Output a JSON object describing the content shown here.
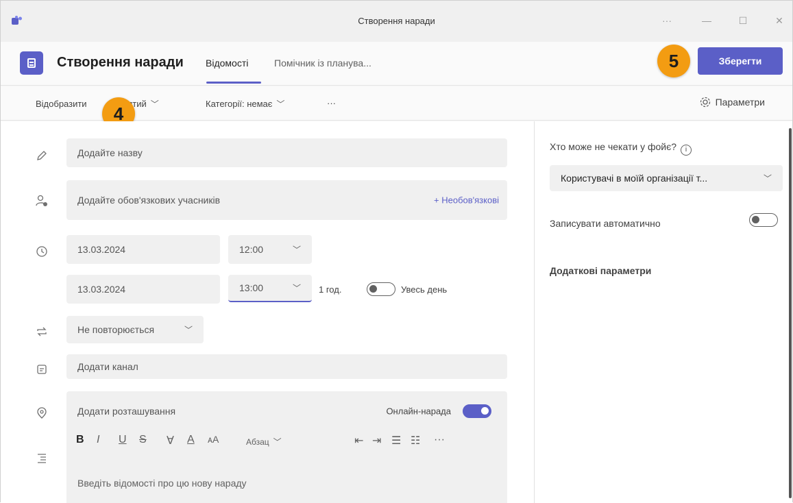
{
  "window": {
    "title": "Створення наради",
    "controls": [
      "···",
      "—",
      "☐",
      "✕"
    ]
  },
  "header": {
    "page_title": "Створення наради",
    "tabs": [
      {
        "label": "Відомості",
        "active": true
      },
      {
        "label": "Помічник із планува..."
      }
    ],
    "save_label": "Зберегти"
  },
  "badges": {
    "step4": "4",
    "step5": "5"
  },
  "toolbar": {
    "show_as_prefix": "Відобразити",
    "show_as_suffix": "айнятий",
    "category": "Категорії: немає",
    "more": "···",
    "settings_label": "Параметри"
  },
  "form": {
    "title_placeholder": "Додайте назву",
    "attendees_placeholder": "Додайте обов'язкових учасників",
    "optional_link": "+ Необов'язкові",
    "start_date": "13.03.2024",
    "start_time": "12:00",
    "end_date": "13.03.2024",
    "end_time": "13:00",
    "duration": "1 год.",
    "all_day_label": "Увесь день",
    "all_day_on": false,
    "repeat": "Не повторюється",
    "channel_placeholder": "Додати канал",
    "location_placeholder": "Додати розташування",
    "online_meeting_label": "Онлайн-нарада",
    "online_meeting_on": true,
    "editor": {
      "tools": [
        "B",
        "I",
        "U",
        "S",
        "∀",
        "A",
        "ᴀA"
      ],
      "paragraph_label": "Абзац",
      "list_tools": [
        "⇤",
        "⇥",
        "☰",
        "☷"
      ],
      "more": "···",
      "placeholder": "Введіть відомості про цю нову нараду"
    }
  },
  "side_panel": {
    "lobby_label": "Хто може не чекати у фойє?",
    "lobby_value": "Користувачі в моїй організації т...",
    "auto_record_label": "Записувати автоматично",
    "auto_record_on": false,
    "more_options_link": "Додаткові параметри"
  },
  "colors": {
    "accent": "#5b5fc7",
    "badge": "#f39c12"
  }
}
